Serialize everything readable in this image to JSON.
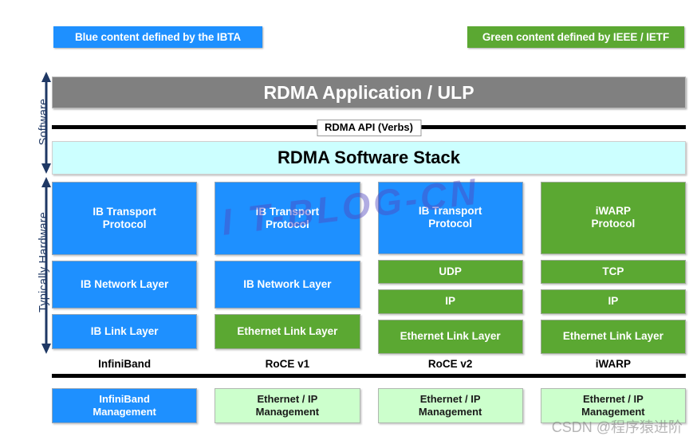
{
  "legend": {
    "blue": {
      "text": "Blue content defined by the IBTA",
      "color": "#1E90FF"
    },
    "green": {
      "text": "Green content defined by IEEE / IETF",
      "color": "#5BA832"
    }
  },
  "axis": {
    "software": "Software",
    "hardware": "Typically Hardware"
  },
  "rows": {
    "application": "RDMA Application / ULP",
    "api": "RDMA API (Verbs)",
    "software_stack": "RDMA Software Stack"
  },
  "columns": [
    {
      "caption": "InfiniBand",
      "cells": [
        {
          "label": "IB Transport\nProtocol",
          "color": "blue",
          "size": "h-transport"
        },
        {
          "label": "IB Network Layer",
          "color": "blue",
          "size": "h-network"
        },
        {
          "label": "IB Link Layer",
          "color": "blue",
          "size": "h-link"
        }
      ],
      "management": {
        "label": "InfiniBand\nManagement",
        "color": "blue"
      }
    },
    {
      "caption": "RoCE v1",
      "cells": [
        {
          "label": "IB Transport\nProtocol",
          "color": "blue",
          "size": "h-transport"
        },
        {
          "label": "IB Network Layer",
          "color": "blue",
          "size": "h-network"
        },
        {
          "label": "Ethernet Link Layer",
          "color": "green",
          "size": "h-link"
        }
      ],
      "management": {
        "label": "Ethernet / IP\nManagement",
        "color": "lightgreen"
      }
    },
    {
      "caption": "RoCE v2",
      "cells": [
        {
          "label": "IB Transport\nProtocol",
          "color": "blue",
          "size": "h-transport"
        },
        {
          "label": "UDP",
          "color": "green",
          "size": "h-thin"
        },
        {
          "label": "IP",
          "color": "green",
          "size": "h-thin"
        },
        {
          "label": "Ethernet Link Layer",
          "color": "green",
          "size": "h-link"
        }
      ],
      "management": {
        "label": "Ethernet / IP\nManagement",
        "color": "lightgreen"
      }
    },
    {
      "caption": "iWARP",
      "cells": [
        {
          "label": "iWARP\nProtocol",
          "color": "green",
          "size": "h-transport"
        },
        {
          "label": "TCP",
          "color": "green",
          "size": "h-thin"
        },
        {
          "label": "IP",
          "color": "green",
          "size": "h-thin"
        },
        {
          "label": "Ethernet Link Layer",
          "color": "green",
          "size": "h-link"
        }
      ],
      "management": {
        "label": "Ethernet / IP\nManagement",
        "color": "lightgreen"
      }
    }
  ],
  "watermarks": {
    "diagonal": "I T-BLOG-CN",
    "corner": "CSDN @程序猿进阶"
  },
  "colors": {
    "blue": "#1E90FF",
    "green": "#5BA832",
    "gray": "#808080",
    "light_cyan": "#CCFFFF",
    "light_green": "#CCFFCC",
    "arrow_navy": "#1F3864",
    "divider_black": "#000000"
  }
}
